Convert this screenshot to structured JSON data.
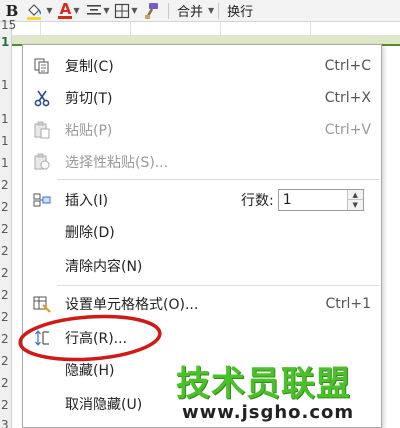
{
  "toolbar": {
    "bold_label": "B",
    "font_color_label": "A",
    "merge_label": "合并",
    "wrap_label": "换行",
    "font_color": "#d52b1e",
    "fill_color": "#f5d53a"
  },
  "row_numbers": [
    "15",
    "1",
    "1",
    "1",
    "1",
    "1",
    "2",
    "2",
    "2",
    "2",
    "2",
    "2",
    "2",
    "2",
    "2",
    "2",
    "2",
    "3"
  ],
  "menu": {
    "copy": {
      "label": "复制(C)",
      "shortcut": "Ctrl+C",
      "icon": "copy-icon"
    },
    "cut": {
      "label": "剪切(T)",
      "shortcut": "Ctrl+X",
      "icon": "scissors-icon"
    },
    "paste": {
      "label": "粘贴(P)",
      "shortcut": "Ctrl+V",
      "icon": "paste-icon"
    },
    "paste_special": {
      "label": "选择性粘贴(S)...",
      "icon": "paste-special-icon"
    },
    "insert": {
      "label": "插入(I)",
      "rows_label": "行数:",
      "rows_value": "1",
      "icon": "insert-rows-icon"
    },
    "delete": {
      "label": "删除(D)"
    },
    "clear": {
      "label": "清除内容(N)"
    },
    "format_cells": {
      "label": "设置单元格格式(O)...",
      "shortcut": "Ctrl+1",
      "icon": "format-cells-icon"
    },
    "row_height": {
      "label": "行高(R)...",
      "icon": "row-height-icon"
    },
    "hide": {
      "label": "隐藏(H)"
    },
    "unhide": {
      "label": "取消隐藏(U)"
    }
  },
  "watermark": {
    "title": "技术员联盟",
    "url": "www.jsgho.com"
  },
  "colors": {
    "accent_green": "#5a8a2e",
    "annotation_red": "#d01a1a",
    "watermark_green": "#4cc02a"
  }
}
